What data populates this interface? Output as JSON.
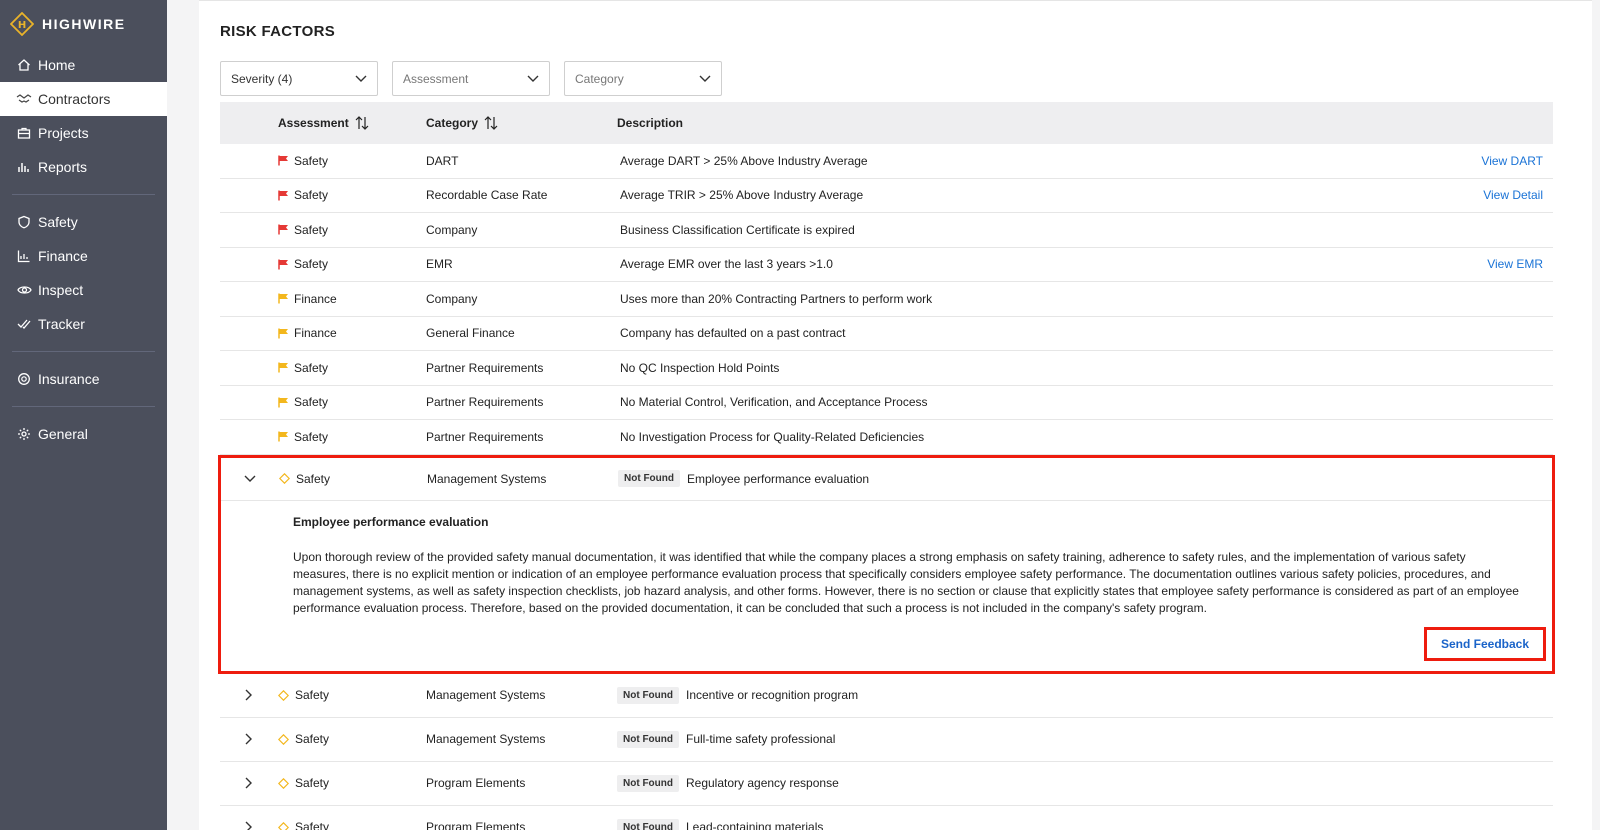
{
  "brand": {
    "name": "HIGHWIRE",
    "accent": "#e9b32a"
  },
  "sidebar": {
    "items": [
      {
        "label": "Home",
        "icon": "home-icon",
        "active": false
      },
      {
        "label": "Contractors",
        "icon": "handshake-icon",
        "active": true
      },
      {
        "label": "Projects",
        "icon": "briefcase-icon",
        "active": false
      },
      {
        "label": "Reports",
        "icon": "bar-chart-icon",
        "active": false
      },
      {
        "label": "Safety",
        "icon": "shield-icon",
        "active": false
      },
      {
        "label": "Finance",
        "icon": "line-chart-icon",
        "active": false
      },
      {
        "label": "Inspect",
        "icon": "eye-icon",
        "active": false
      },
      {
        "label": "Tracker",
        "icon": "double-check-icon",
        "active": false
      },
      {
        "label": "Insurance",
        "icon": "lifebuoy-icon",
        "active": false
      },
      {
        "label": "General",
        "icon": "gear-icon",
        "active": false
      }
    ]
  },
  "page": {
    "title": "RISK FACTORS"
  },
  "filters": [
    {
      "label": "Severity (4)",
      "placeholder": false
    },
    {
      "label": "Assessment",
      "placeholder": true
    },
    {
      "label": "Category",
      "placeholder": true
    }
  ],
  "table": {
    "headers": {
      "assessment": "Assessment",
      "category": "Category",
      "description": "Description"
    },
    "rows": [
      {
        "flag": "red",
        "assessment": "Safety",
        "category": "DART",
        "description": "Average DART > 25% Above Industry Average",
        "action": "View DART"
      },
      {
        "flag": "red",
        "assessment": "Safety",
        "category": "Recordable Case Rate",
        "description": "Average TRIR > 25% Above Industry Average",
        "action": "View Detail"
      },
      {
        "flag": "red",
        "assessment": "Safety",
        "category": "Company",
        "description": "Business Classification Certificate is expired",
        "action": ""
      },
      {
        "flag": "red",
        "assessment": "Safety",
        "category": "EMR",
        "description": "Average EMR over the last 3 years >1.0",
        "action": "View EMR"
      },
      {
        "flag": "yellow",
        "assessment": "Finance",
        "category": "Company",
        "description": "Uses more than 20% Contracting Partners to perform work",
        "action": ""
      },
      {
        "flag": "yellow",
        "assessment": "Finance",
        "category": "General Finance",
        "description": "Company has defaulted on a past contract",
        "action": ""
      },
      {
        "flag": "yellow",
        "assessment": "Safety",
        "category": "Partner Requirements",
        "description": "No QC Inspection Hold Points",
        "action": ""
      },
      {
        "flag": "yellow",
        "assessment": "Safety",
        "category": "Partner Requirements",
        "description": "No Material Control, Verification, and Acceptance Process",
        "action": ""
      },
      {
        "flag": "yellow",
        "assessment": "Safety",
        "category": "Partner Requirements",
        "description": "No Investigation Process for Quality-Related Deficiencies",
        "action": ""
      }
    ],
    "expanded": {
      "assessment": "Safety",
      "category": "Management Systems",
      "badge": "Not Found",
      "description": "Employee performance evaluation",
      "detail_title": "Employee performance evaluation",
      "detail_text": "Upon thorough review of the provided safety manual documentation, it was identified that while the company places a strong emphasis on safety training, adherence to safety rules, and the implementation of various safety measures, there is no explicit mention or indication of an employee performance evaluation process that specifically considers employee safety performance. The documentation outlines various safety policies, procedures, and management systems, as well as safety inspection checklists, job hazard analysis, and other forms. However, there is no section or clause that explicitly states that employee safety performance is considered as part of an employee performance evaluation process. Therefore, based on the provided documentation, it can be concluded that such a process is not included in the company's safety program.",
      "feedback_label": "Send Feedback"
    },
    "collapsed": [
      {
        "assessment": "Safety",
        "category": "Management Systems",
        "badge": "Not Found",
        "description": "Incentive or recognition program"
      },
      {
        "assessment": "Safety",
        "category": "Management Systems",
        "badge": "Not Found",
        "description": "Full-time safety professional"
      },
      {
        "assessment": "Safety",
        "category": "Program Elements",
        "badge": "Not Found",
        "description": "Regulatory agency response"
      },
      {
        "assessment": "Safety",
        "category": "Program Elements",
        "badge": "Not Found",
        "description": "Lead-containing materials"
      }
    ]
  },
  "colors": {
    "flag_red": "#e53935",
    "flag_yellow": "#f3b71d",
    "link": "#1a73d6",
    "highlight": "#ee1c0e"
  }
}
